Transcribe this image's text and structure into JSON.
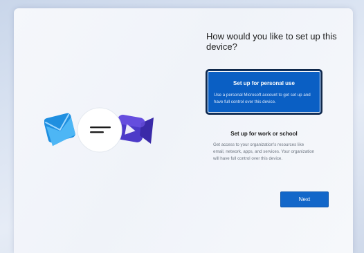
{
  "setup": {
    "title": "How would you like to set up this device?",
    "options": [
      {
        "label": "Set up for personal use",
        "description": "Use a personal Microsoft account to get set up and have full control over this device.",
        "selected": true
      },
      {
        "label": "Set up for work or school",
        "description": "Get access to your organization's resources like email, network, apps, and services. Your organization will have full control over this device.",
        "selected": false
      }
    ],
    "next_label": "Next"
  },
  "illustration": {
    "icons": [
      "mail-icon",
      "chat-bubble-icon",
      "video-camera-icon"
    ]
  },
  "colors": {
    "accent": "#0a5fc4",
    "button": "#1367c9",
    "mail_blue": "#2b9be6",
    "video_purple": "#5a3fd0"
  }
}
